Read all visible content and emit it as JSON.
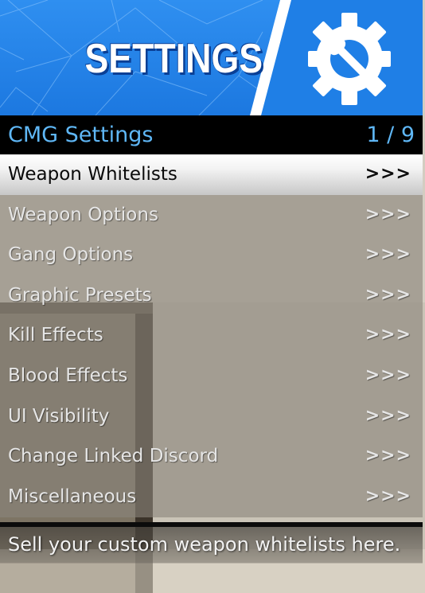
{
  "banner": {
    "title": "SETTINGS",
    "icon": "gear-wrench-icon",
    "color": "#1f7fe6"
  },
  "header": {
    "title": "CMG Settings",
    "counter": "1 / 9"
  },
  "menu": {
    "selected_index": 0,
    "items": [
      {
        "label": "Weapon Whitelists",
        "arrows": ">>>"
      },
      {
        "label": "Weapon Options",
        "arrows": ">>>"
      },
      {
        "label": "Gang Options",
        "arrows": ">>>"
      },
      {
        "label": "Graphic Presets",
        "arrows": ">>>"
      },
      {
        "label": "Kill Effects",
        "arrows": ">>>"
      },
      {
        "label": "Blood Effects",
        "arrows": ">>>"
      },
      {
        "label": "UI Visibility",
        "arrows": ">>>"
      },
      {
        "label": "Change Linked Discord",
        "arrows": ">>>"
      },
      {
        "label": "Miscellaneous",
        "arrows": ">>>"
      }
    ]
  },
  "description": "Sell your custom weapon whitelists here."
}
